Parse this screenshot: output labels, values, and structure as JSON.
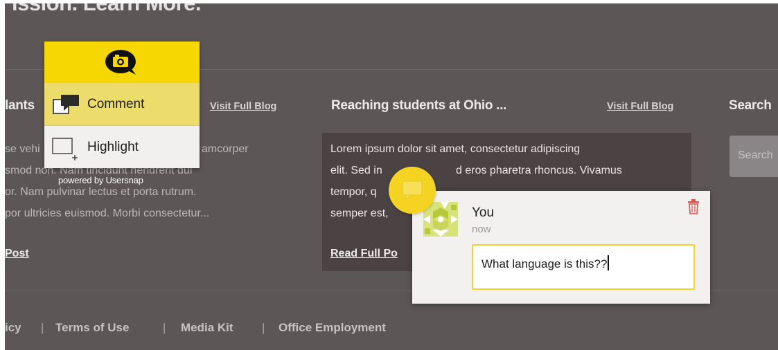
{
  "page": {
    "heading": "ission. Learn More."
  },
  "columns": [
    {
      "title": "lants",
      "visit_link": "Visit Full Blog",
      "lines": [
        "se vehi",
        "amcorper",
        "smod non. Nam tincidunt hendrerit dui",
        "or. Nam pulvinar lectus et porta rutrum.",
        "por ultricies euismod. Morbi consectetur..."
      ],
      "read_more": "Post"
    },
    {
      "title": "Reaching students at Ohio ...",
      "visit_link": "Visit Full Blog",
      "lines": [
        "Lorem ipsum dolor sit amet, consectetur adipiscing",
        "elit. Sed in",
        "d eros pharetra rhoncus. Vivamus",
        "tempor, q",
        "semper est,"
      ],
      "read_more": "Read Full Po"
    },
    {
      "title": "Search",
      "search_placeholder": "Search"
    }
  ],
  "footer": {
    "links": [
      "icy",
      "Terms of Use",
      "Media Kit",
      "Office Employment"
    ],
    "separator": "|"
  },
  "usersnap": {
    "comment_label": "Comment",
    "highlight_label": "Highlight",
    "powered_by": "powered by Usersnap",
    "brand_color": "#f6d700"
  },
  "comment_popup": {
    "user": "You",
    "time": "now",
    "text": "What language is this??",
    "accent": "#f4d322",
    "delete_color": "#d9534f"
  },
  "icons": [
    "camera-bubble-icon",
    "comment-icon",
    "highlight-icon",
    "pin-comment-icon",
    "user-avatar",
    "trash-icon"
  ]
}
